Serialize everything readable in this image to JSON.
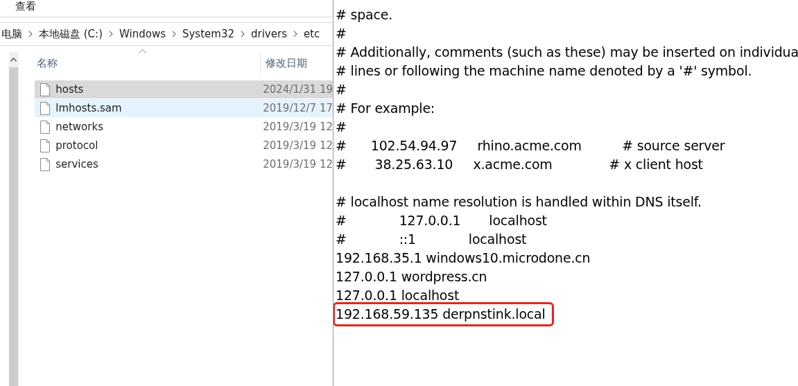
{
  "explorer": {
    "menu": [
      "查看"
    ],
    "breadcrumb": [
      "电脑",
      "本地磁盘 (C:)",
      "Windows",
      "System32",
      "drivers",
      "etc"
    ],
    "columns": [
      "名称",
      "修改日期"
    ],
    "files": [
      {
        "name": "hosts",
        "date": "2024/1/31 19",
        "selected": true,
        "hovered": false
      },
      {
        "name": "lmhosts.sam",
        "date": "2019/12/7 17",
        "selected": false,
        "hovered": true
      },
      {
        "name": "networks",
        "date": "2019/3/19 12",
        "selected": false,
        "hovered": false
      },
      {
        "name": "protocol",
        "date": "2019/3/19 12",
        "selected": false,
        "hovered": false
      },
      {
        "name": "services",
        "date": "2019/3/19 12",
        "selected": false,
        "hovered": false
      }
    ]
  },
  "notepad": {
    "paragraphs": [
      {
        "lines": [
          {
            "text": "# space.",
            "highlighted": false
          },
          {
            "text": "#",
            "highlighted": false
          },
          {
            "text": "# Additionally, comments (such as these) may be inserted on individua",
            "highlighted": false
          },
          {
            "text": "# lines or following the machine name denoted by a '#' symbol.",
            "highlighted": false
          },
          {
            "text": "#",
            "highlighted": false
          },
          {
            "text": "# For example:",
            "highlighted": false
          },
          {
            "text": "#",
            "highlighted": false
          },
          {
            "text": "#      102.54.94.97     rhino.acme.com          # source server",
            "highlighted": false
          },
          {
            "text": "#       38.25.63.10     x.acme.com              # x client host",
            "highlighted": false
          }
        ]
      },
      {
        "lines": [
          {
            "text": "# localhost name resolution is handled within DNS itself.",
            "highlighted": false
          },
          {
            "text": "#             127.0.0.1       localhost",
            "highlighted": false
          },
          {
            "text": "#             ::1             localhost",
            "highlighted": false
          },
          {
            "text": "192.168.35.1 windows10.microdone.cn",
            "highlighted": false
          },
          {
            "text": "127.0.0.1 wordpress.cn",
            "highlighted": false
          },
          {
            "text": "127.0.0.1 localhost",
            "highlighted": false
          },
          {
            "text": "192.168.59.135 derpnstink.local",
            "highlighted": true
          }
        ]
      }
    ]
  }
}
